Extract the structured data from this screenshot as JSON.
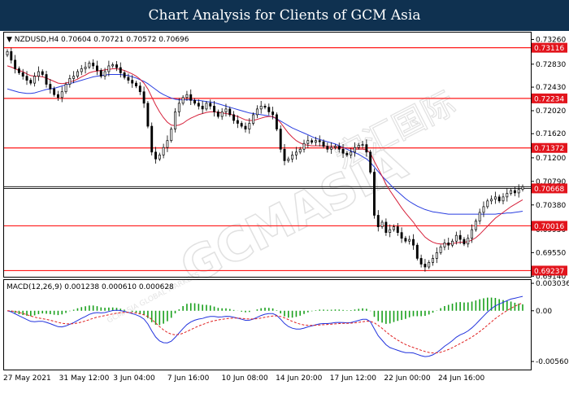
{
  "banner": {
    "title": "Chart Analysis for Clients of GCM Asia"
  },
  "watermark": {
    "brand": "GCMASIA",
    "chinese": "宏汇国际",
    "tagline": "GCMASIA GLOBAL MARKETS"
  },
  "colors": {
    "bg": "#ffffff",
    "frame": "#000000",
    "bull": "#000000",
    "bear": "#000000",
    "ma_fast": "#d6203a",
    "ma_slow": "#2a3ee0",
    "level_line": "#ff1a1a",
    "level_label_bg": "#e2141c",
    "level_label_text": "#ffffff",
    "current_line": "#000000",
    "current_label_bg": "#e2141c",
    "macd_hist": "#19a01c",
    "macd_signal": "#e02020",
    "macd_line": "#2233dd"
  },
  "chart_data": [
    {
      "type": "line",
      "subtype": "candlestick",
      "header": "▼ NZDUSD,H4  0.70604 0.70721 0.70572 0.70696",
      "symbol": "NZDUSD",
      "timeframe": "H4",
      "ohlc": {
        "open": 0.70604,
        "high": 0.70721,
        "low": 0.70572,
        "close": 0.70696
      },
      "ylim": [
        0.6913,
        0.7338
      ],
      "y_ticks": [
        "0.73260",
        "0.72830",
        "0.72430",
        "0.72020",
        "0.71620",
        "0.71200",
        "0.70790",
        "0.70380",
        "0.69950",
        "0.69550",
        "0.69140"
      ],
      "x_ticks": [
        "27 May 2021",
        "31 May 12:00",
        "3 Jun 04:00",
        "7 Jun 16:00",
        "10 Jun 08:00",
        "14 Jun 20:00",
        "17 Jun 12:00",
        "22 Jun 00:00",
        "24 Jun 16:00"
      ],
      "levels": [
        "0.73116",
        "0.72234",
        "0.71372",
        "0.70016",
        "0.69237"
      ],
      "current_price": "0.70668",
      "grid": false,
      "closes": [
        0.7305,
        0.729,
        0.7275,
        0.7268,
        0.7262,
        0.7255,
        0.725,
        0.7262,
        0.727,
        0.7265,
        0.7248,
        0.724,
        0.723,
        0.7225,
        0.7235,
        0.7248,
        0.7258,
        0.7262,
        0.727,
        0.7275,
        0.7278,
        0.7285,
        0.728,
        0.7272,
        0.7262,
        0.727,
        0.728,
        0.7282,
        0.7277,
        0.7268,
        0.726,
        0.7255,
        0.725,
        0.7245,
        0.7235,
        0.7215,
        0.7175,
        0.713,
        0.7118,
        0.7125,
        0.7138,
        0.715,
        0.717,
        0.72,
        0.7215,
        0.7225,
        0.723,
        0.722,
        0.7215,
        0.721,
        0.7205,
        0.7215,
        0.721,
        0.72,
        0.7192,
        0.72,
        0.7205,
        0.7195,
        0.7185,
        0.718,
        0.7175,
        0.717,
        0.718,
        0.7195,
        0.7205,
        0.721,
        0.7208,
        0.72,
        0.7195,
        0.717,
        0.7135,
        0.7115,
        0.7118,
        0.7125,
        0.713,
        0.7135,
        0.7145,
        0.715,
        0.7147,
        0.715,
        0.7148,
        0.714,
        0.7135,
        0.7138,
        0.714,
        0.7135,
        0.7128,
        0.7125,
        0.713,
        0.7138,
        0.7142,
        0.7143,
        0.713,
        0.7095,
        0.702,
        0.7,
        0.7008,
        0.699,
        0.6995,
        0.7,
        0.699,
        0.698,
        0.6975,
        0.6978,
        0.6968,
        0.6945,
        0.6935,
        0.693,
        0.6938,
        0.6945,
        0.6955,
        0.6965,
        0.6972,
        0.6968,
        0.6975,
        0.6985,
        0.6978,
        0.697,
        0.698,
        0.6995,
        0.701,
        0.7025,
        0.7035,
        0.7045,
        0.7048,
        0.7052,
        0.7045,
        0.7052,
        0.7058,
        0.7063,
        0.7059,
        0.7065,
        0.70696
      ],
      "ma_fast": [
        0.728,
        0.7278,
        0.7275,
        0.7272,
        0.727,
        0.7266,
        0.7263,
        0.7262,
        0.7262,
        0.7261,
        0.7259,
        0.7256,
        0.7253,
        0.725,
        0.7249,
        0.725,
        0.7252,
        0.7254,
        0.7257,
        0.7261,
        0.7264,
        0.7268,
        0.727,
        0.7271,
        0.7272,
        0.7273,
        0.7274,
        0.7275,
        0.7275,
        0.7274,
        0.7272,
        0.7269,
        0.7266,
        0.7262,
        0.7257,
        0.725,
        0.724,
        0.7226,
        0.7212,
        0.72,
        0.719,
        0.7182,
        0.7177,
        0.7176,
        0.7177,
        0.718,
        0.7185,
        0.7189,
        0.7192,
        0.7195,
        0.7197,
        0.7199,
        0.72,
        0.72,
        0.7199,
        0.7198,
        0.7197,
        0.7196,
        0.7194,
        0.7192,
        0.7189,
        0.7186,
        0.7185,
        0.7185,
        0.7187,
        0.7189,
        0.7191,
        0.7192,
        0.7192,
        0.7188,
        0.7181,
        0.7172,
        0.7163,
        0.7156,
        0.715,
        0.7146,
        0.7143,
        0.7142,
        0.7141,
        0.7141,
        0.7141,
        0.7141,
        0.714,
        0.714,
        0.714,
        0.7139,
        0.7138,
        0.7137,
        0.7136,
        0.7135,
        0.7135,
        0.7135,
        0.7134,
        0.7128,
        0.7114,
        0.7101,
        0.7088,
        0.7074,
        0.7063,
        0.7053,
        0.7043,
        0.7033,
        0.7024,
        0.7016,
        0.7008,
        0.6998,
        0.699,
        0.6982,
        0.6977,
        0.6973,
        0.6971,
        0.697,
        0.697,
        0.697,
        0.6971,
        0.6972,
        0.6973,
        0.6973,
        0.6974,
        0.6977,
        0.6981,
        0.6987,
        0.6994,
        0.7001,
        0.7008,
        0.7015,
        0.702,
        0.7025,
        0.703,
        0.7035,
        0.7039,
        0.7043,
        0.7047
      ],
      "ma_slow": [
        0.724,
        0.7238,
        0.7236,
        0.7234,
        0.7233,
        0.7232,
        0.7232,
        0.7233,
        0.7235,
        0.7237,
        0.7239,
        0.724,
        0.7241,
        0.7243,
        0.7245,
        0.7247,
        0.7249,
        0.7251,
        0.7253,
        0.7255,
        0.7257,
        0.7259,
        0.7261,
        0.7262,
        0.7263,
        0.7264,
        0.7265,
        0.7265,
        0.7265,
        0.7265,
        0.7264,
        0.7263,
        0.7261,
        0.7259,
        0.7256,
        0.7253,
        0.7249,
        0.7244,
        0.7239,
        0.7234,
        0.723,
        0.7227,
        0.7224,
        0.7222,
        0.7221,
        0.7221,
        0.7221,
        0.7221,
        0.722,
        0.722,
        0.7219,
        0.7218,
        0.7217,
        0.7216,
        0.7214,
        0.7212,
        0.721,
        0.7208,
        0.7206,
        0.7204,
        0.7202,
        0.72,
        0.7198,
        0.7197,
        0.7196,
        0.7195,
        0.7194,
        0.7193,
        0.7191,
        0.7188,
        0.7184,
        0.718,
        0.7176,
        0.7172,
        0.7169,
        0.7166,
        0.7163,
        0.716,
        0.7157,
        0.7154,
        0.7152,
        0.715,
        0.7148,
        0.7146,
        0.7144,
        0.7141,
        0.7138,
        0.7135,
        0.7132,
        0.7129,
        0.7126,
        0.7122,
        0.7118,
        0.7112,
        0.7104,
        0.7096,
        0.7088,
        0.7081,
        0.7074,
        0.7067,
        0.7061,
        0.7055,
        0.7049,
        0.7044,
        0.704,
        0.7036,
        0.7033,
        0.703,
        0.7028,
        0.7026,
        0.7025,
        0.7024,
        0.7023,
        0.7022,
        0.7022,
        0.7022,
        0.7022,
        0.7022,
        0.7022,
        0.7022,
        0.7022,
        0.7022,
        0.7022,
        0.7022,
        0.7022,
        0.7022,
        0.7023,
        0.7023,
        0.7024,
        0.7024,
        0.7025,
        0.7026,
        0.7027
      ]
    },
    {
      "type": "bar",
      "subtype": "macd",
      "label": "MACD(12,26,9) 0.001238 0.000610 0.000628",
      "params": "12,26,9",
      "values": {
        "macd": 0.001238,
        "signal": 0.00061,
        "histogram": 0.000628
      },
      "ylim": [
        -0.0065,
        0.0034
      ],
      "y_ticks": [
        "0.003036",
        "0.00",
        "-0.005607"
      ],
      "grid": false
    }
  ]
}
